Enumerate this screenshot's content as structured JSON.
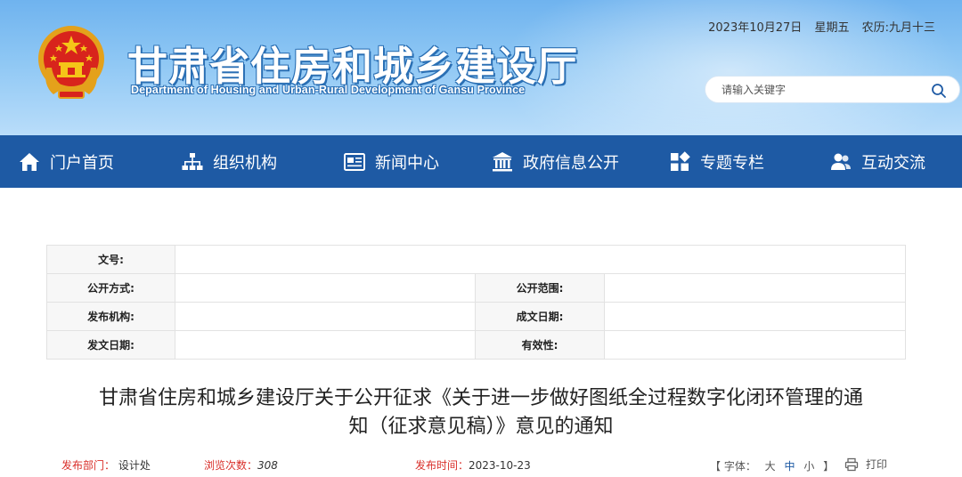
{
  "header": {
    "title": "甘肃省住房和城乡建设厅",
    "subtitle": "Department of Housing and Urban-Rural Development of Gansu Province",
    "date": "2023年10月27日",
    "weekday": "星期五",
    "lunar": "农历:九月十三",
    "search_placeholder": "请输入关键字",
    "emblem_icon": "national-emblem-icon"
  },
  "nav": {
    "items": [
      {
        "label": "门户首页",
        "icon": "home-icon"
      },
      {
        "label": "组织机构",
        "icon": "org-chart-icon"
      },
      {
        "label": "新闻中心",
        "icon": "newspaper-icon"
      },
      {
        "label": "政府信息公开",
        "icon": "government-building-icon"
      },
      {
        "label": "专题专栏",
        "icon": "grid-icon"
      },
      {
        "label": "互动交流",
        "icon": "users-icon"
      }
    ],
    "bg_color": "#1e5aa4"
  },
  "meta": {
    "doc_no_label": "文号:",
    "open_mode_label": "公开方式:",
    "open_scope_label": "公开范围:",
    "issuer_label": "发布机构:",
    "written_date_label": "成文日期:",
    "issue_date_label": "发文日期:",
    "validity_label": "有效性:"
  },
  "article": {
    "title_line1": "甘肃省住房和城乡建设厅关于公开征求《关于进一步做好图纸全过程数字化闭环管理的通",
    "title_line2": "知（征求意见稿）》意见的通知",
    "dept_label": "发布部门：",
    "dept_value": "设计处",
    "views_label": "浏览次数：",
    "views_value": "308",
    "time_label": "发布时间：",
    "time_value": "2023-10-23",
    "font_bracket_open": "【 字体：",
    "font_large": "大",
    "font_medium": "中",
    "font_small": "小",
    "font_bracket_close": "】",
    "print_label": "打印"
  }
}
